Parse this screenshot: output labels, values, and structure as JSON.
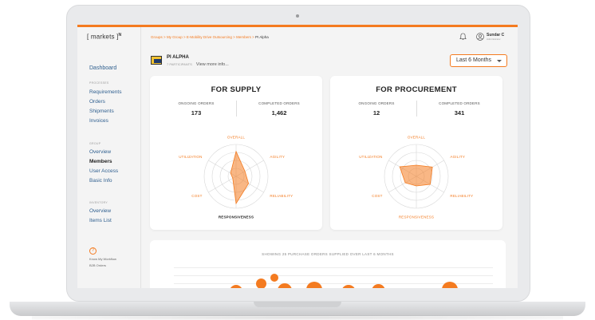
{
  "app": {
    "logo": "[ markets ]",
    "logo_sup": "N"
  },
  "sidebar": {
    "dashboard": "Dashboard",
    "sections": [
      {
        "title": "PROCESSES",
        "items": [
          "Requirements",
          "Orders",
          "Shipments",
          "Invoices"
        ]
      },
      {
        "title": "GROUP",
        "items": [
          "Overview",
          "Members",
          "User Access",
          "Basic Info"
        ],
        "active": "Members"
      },
      {
        "title": "INVENTORY",
        "items": [
          "Overview",
          "Items List"
        ]
      }
    ],
    "help_icon": "question-icon",
    "help_title": "Know My Workflow",
    "help_sub": "B2B Orders"
  },
  "header": {
    "breadcrumb": [
      "Groups",
      "My Group",
      "E-Mobility Drive Outsourcing",
      "Members"
    ],
    "breadcrumb_current": "PI Alpha",
    "breadcrumb_sep": ">",
    "user_name": "Sundar C",
    "user_role": "Administrator",
    "bell_icon": "bell-icon",
    "user_icon": "user-circle-icon"
  },
  "group": {
    "name": "PI ALPHA",
    "participants": "7 PARTICIPANTS",
    "more_link": "View more info..."
  },
  "period": {
    "selected": "Last 6 Months"
  },
  "supply": {
    "title": "FOR SUPPLY",
    "ongoing_label": "ONGOING ORDERS",
    "ongoing_value": "173",
    "completed_label": "COMPLETED ORDERS",
    "completed_value": "1,462",
    "axes": [
      "OVERALL",
      "AGILITY",
      "RELIABILITY",
      "RESPONSIVENESS",
      "COST",
      "UTILIZATION"
    ],
    "values": [
      0.78,
      0.32,
      0.45,
      0.85,
      0.12,
      0.2
    ]
  },
  "procurement": {
    "title": "FOR PROCUREMENT",
    "ongoing_label": "ONGOING ORDERS",
    "ongoing_value": "12",
    "completed_label": "COMPLETED ORDERS",
    "completed_value": "341",
    "axes": [
      "OVERALL",
      "AGILITY",
      "RELIABILITY",
      "RESPONSIVENESS",
      "COST",
      "UTILIZATION"
    ],
    "values": [
      0.35,
      0.58,
      0.5,
      0.3,
      0.4,
      0.6
    ]
  },
  "orders_chart": {
    "title": "SHOWING 25 PURCHASE ORDERS SUPPLIED OVER LAST 6 MONTHS"
  },
  "colors": {
    "accent": "#f47b20",
    "link": "#2f5f8f"
  }
}
